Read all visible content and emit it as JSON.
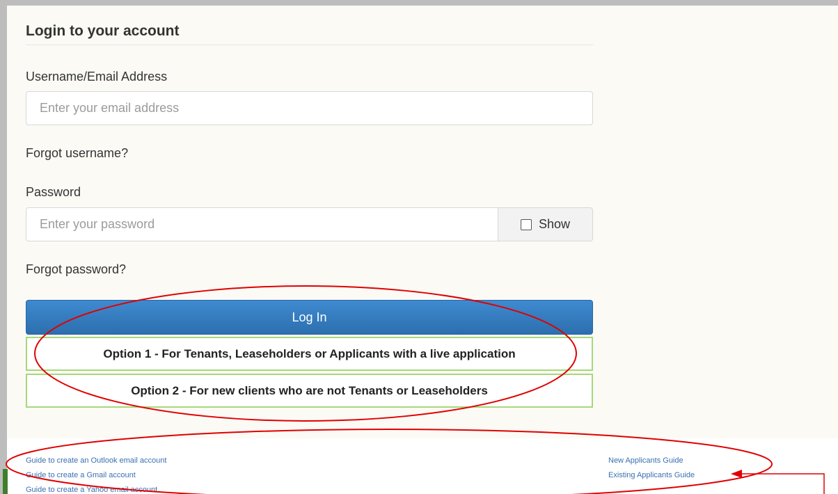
{
  "form": {
    "heading": "Login to your account",
    "username_label": "Username/Email Address",
    "username_placeholder": "Enter your email address",
    "forgot_username": "Forgot username?",
    "password_label": "Password",
    "password_placeholder": "Enter your password",
    "show_label": "Show",
    "forgot_password": "Forgot password?",
    "login_button": "Log In",
    "option1": "Option 1 - For Tenants, Leaseholders or Applicants with a live application",
    "option2": "Option 2 - For new clients who are not Tenants or Leaseholders"
  },
  "footer": {
    "left_links": [
      "Guide to create an Outlook email account",
      "Guide to create a Gmail account",
      "Guide to create a Yahoo email account"
    ],
    "right_links": [
      "New Applicants Guide",
      "Existing Applicants Guide"
    ]
  },
  "colors": {
    "annotation": "#e00000",
    "primary_button": "#337ab7",
    "option_border": "#a6d87a",
    "panel_bg": "#fbfaf5"
  }
}
